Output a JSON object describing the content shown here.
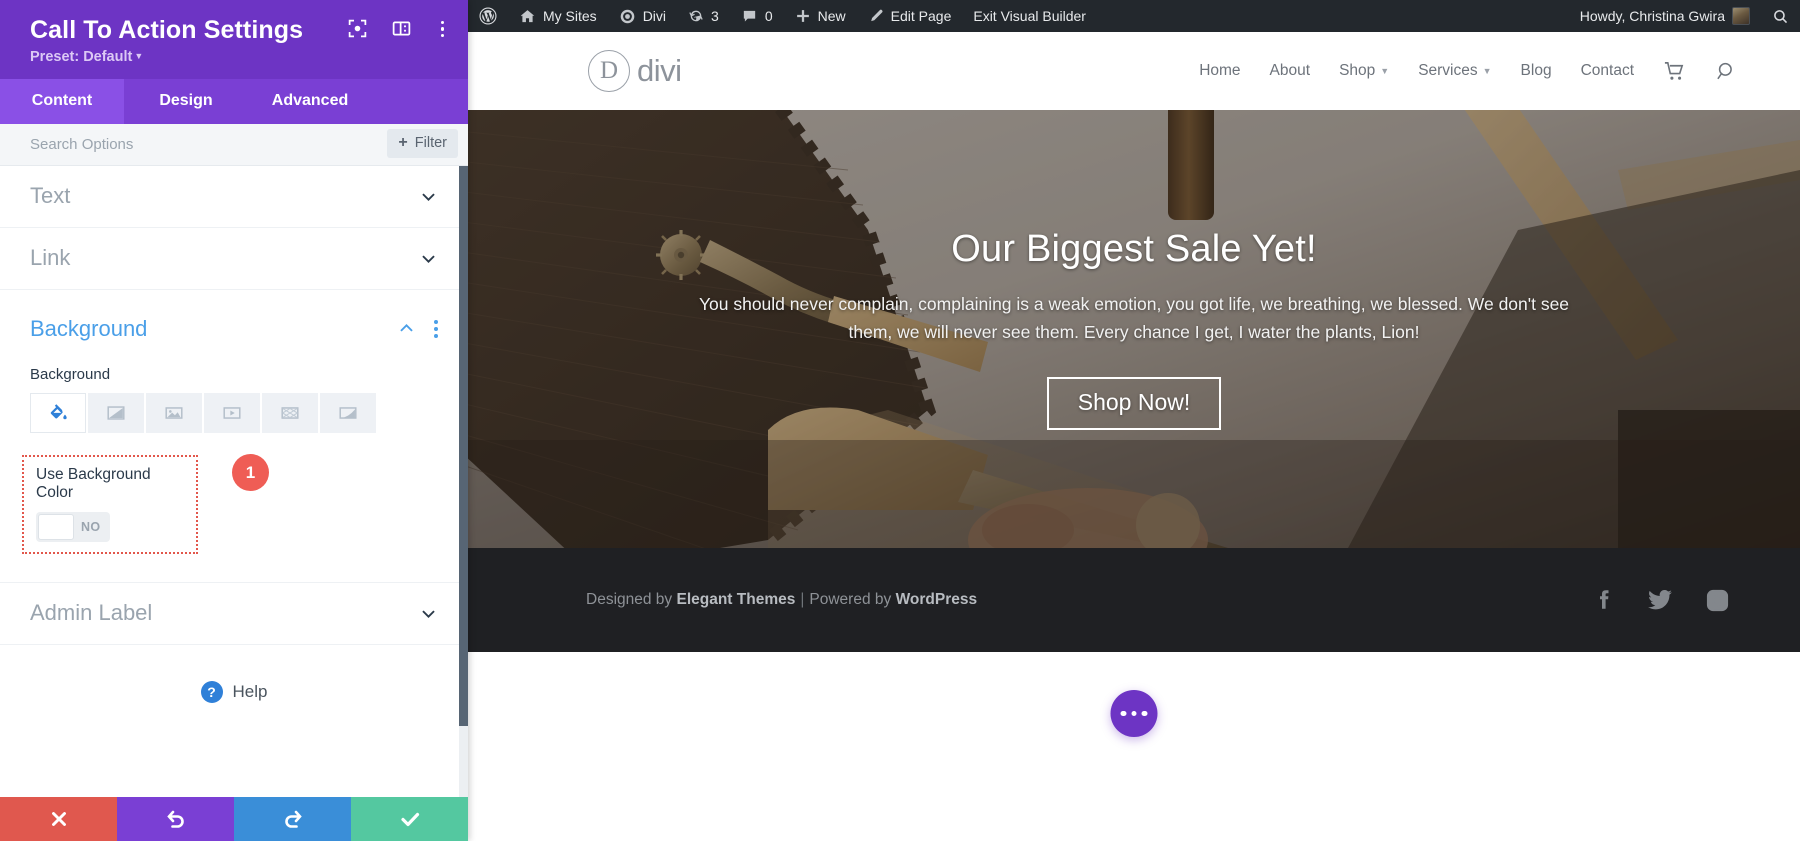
{
  "settings_panel": {
    "title": "Call To Action Settings",
    "preset_label": "Preset: Default",
    "header_icons": [
      {
        "name": "focus-icon"
      },
      {
        "name": "layout-panel-icon"
      },
      {
        "name": "kebab-menu-icon"
      }
    ],
    "tabs": [
      {
        "label": "Content",
        "active": true
      },
      {
        "label": "Design",
        "active": false
      },
      {
        "label": "Advanced",
        "active": false
      }
    ],
    "search": {
      "placeholder": "Search Options",
      "value": ""
    },
    "filter_button": "Filter",
    "sections": [
      {
        "label": "Text",
        "open": false
      },
      {
        "label": "Link",
        "open": false
      },
      {
        "label": "Background",
        "open": true
      },
      {
        "label": "Admin Label",
        "open": false
      }
    ],
    "background_section": {
      "heading": "Background",
      "field_label": "Background",
      "types": [
        {
          "name": "background-color-icon",
          "label": "Background Color",
          "active": true
        },
        {
          "name": "background-gradient-icon",
          "label": "Background Gradient",
          "active": false
        },
        {
          "name": "background-image-icon",
          "label": "Background Image",
          "active": false
        },
        {
          "name": "background-video-icon",
          "label": "Background Video",
          "active": false
        },
        {
          "name": "background-pattern-icon",
          "label": "Background Pattern",
          "active": false
        },
        {
          "name": "background-mask-icon",
          "label": "Background Mask",
          "active": false
        }
      ],
      "toggle": {
        "label": "Use Background Color",
        "state": "NO"
      },
      "annotation_badge": "1"
    },
    "help_label": "Help",
    "footer_buttons": [
      {
        "name": "cancel-button",
        "icon": "close-icon",
        "color": "#e0584e"
      },
      {
        "name": "undo-button",
        "icon": "undo-icon",
        "color": "#7a3fd4"
      },
      {
        "name": "redo-button",
        "icon": "redo-icon",
        "color": "#3a8ed8"
      },
      {
        "name": "save-button",
        "icon": "check-icon",
        "color": "#54c8a0"
      }
    ],
    "colors": {
      "header": "#6d34c4",
      "tabs": "#7a3fd4",
      "tab_active": "#8a50e6",
      "section_open_title": "#4a9fe8",
      "annotation": "#ef5d55"
    }
  },
  "admin_bar": {
    "items": [
      {
        "label": "",
        "icon": "wordpress-logo-icon"
      },
      {
        "label": "My Sites",
        "icon": "sites-icon"
      },
      {
        "label": "Divi",
        "icon": "divi-dashboard-icon"
      },
      {
        "label": "3",
        "icon": "updates-icon"
      },
      {
        "label": "0",
        "icon": "comments-icon"
      },
      {
        "label": "New",
        "icon": "plus-icon"
      },
      {
        "label": "Edit Page",
        "icon": "pencil-icon"
      },
      {
        "label": "Exit Visual Builder",
        "icon": ""
      }
    ],
    "howdy": "Howdy, Christina Gwira",
    "search_icon": "search-icon"
  },
  "site": {
    "logo_letter": "D",
    "logo_text": "divi",
    "nav": [
      {
        "label": "Home",
        "dropdown": false
      },
      {
        "label": "About",
        "dropdown": false
      },
      {
        "label": "Shop",
        "dropdown": true
      },
      {
        "label": "Services",
        "dropdown": true
      },
      {
        "label": "Blog",
        "dropdown": false
      },
      {
        "label": "Contact",
        "dropdown": false
      }
    ],
    "nav_icons": [
      {
        "name": "cart-icon"
      },
      {
        "name": "search-icon"
      }
    ],
    "hero": {
      "title": "Our Biggest Sale Yet!",
      "body": "You should never complain, complaining is a weak emotion, you got life, we breathing, we blessed. We don't see them, we will never see them. Every chance I get, I water the plants, Lion!",
      "button": "Shop Now!"
    },
    "footer": {
      "designed_by": "Designed by",
      "elegant_themes": "Elegant Themes",
      "separator": "|",
      "powered_by": "Powered by",
      "wordpress": "WordPress",
      "social": [
        {
          "name": "facebook-icon"
        },
        {
          "name": "twitter-icon"
        },
        {
          "name": "instagram-icon"
        }
      ]
    },
    "fab": {
      "name": "divi-menu-fab",
      "label": "..."
    }
  }
}
